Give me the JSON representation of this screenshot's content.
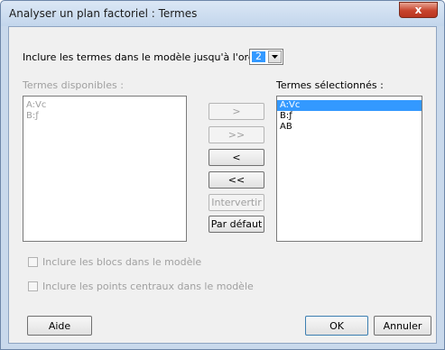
{
  "window": {
    "title": "Analyser un plan factoriel : Termes",
    "close_glyph": "x"
  },
  "order": {
    "label": "Inclure les termes dans le modèle jusqu'à l'ordre :",
    "value": "2"
  },
  "available": {
    "label": "Termes disponibles :",
    "items": [
      "A:Vc",
      "B:ƒ"
    ]
  },
  "selected": {
    "label": "Termes sélectionnés :",
    "items": [
      "A:Vc",
      "B:ƒ",
      "AB"
    ],
    "highlighted_index": 0
  },
  "buttons": {
    "add": ">",
    "add_all": ">>",
    "remove": "<",
    "remove_all": "<<",
    "swap": "Intervertir",
    "default": "Par défaut",
    "help": "Aide",
    "ok": "OK",
    "cancel": "Annuler"
  },
  "options": {
    "include_blocks": "Inclure les blocs dans le modèle",
    "include_center_points": "Inclure les points centraux dans le modèle"
  },
  "colors": {
    "selection": "#3399ff",
    "close_button": "#c7442d"
  },
  "icons": {
    "dropdown": "chevron-down-icon",
    "close": "close-icon"
  }
}
